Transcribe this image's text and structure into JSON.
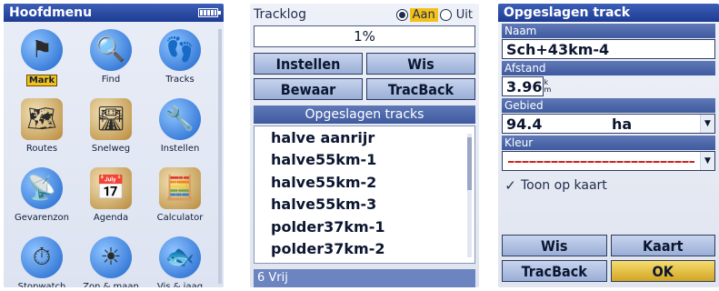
{
  "menu": {
    "title": "Hoofdmenu",
    "items": [
      {
        "label": "Mark",
        "icon": "mark-flag-icon",
        "glyph": "⚑",
        "selected": true
      },
      {
        "label": "Find",
        "icon": "magnifier-icon",
        "glyph": "🔍"
      },
      {
        "label": "Tracks",
        "icon": "tracks-icon",
        "glyph": "👣"
      },
      {
        "label": "Routes",
        "icon": "routes-map-icon",
        "glyph": "🗺"
      },
      {
        "label": "Snelweg",
        "icon": "highway-icon",
        "glyph": "🛣"
      },
      {
        "label": "Instellen",
        "icon": "wrench-icon",
        "glyph": "🔧"
      },
      {
        "label": "Gevarenzon",
        "icon": "proximity-icon",
        "glyph": "📡"
      },
      {
        "label": "Agenda",
        "icon": "calendar-icon",
        "glyph": "📅"
      },
      {
        "label": "Calculator",
        "icon": "calculator-icon",
        "glyph": "🧮"
      },
      {
        "label": "Stopwatch",
        "icon": "stopwatch-icon",
        "glyph": "⏱"
      },
      {
        "label": "Zon & maan",
        "icon": "sun-moon-icon",
        "glyph": "☀"
      },
      {
        "label": "Vis & jaag",
        "icon": "fish-hunt-icon",
        "glyph": "🐟"
      }
    ]
  },
  "tracks": {
    "tracklog_label": "Tracklog",
    "on_label": "Aan",
    "off_label": "Uit",
    "on_selected": true,
    "progress_text": "1%",
    "progress_fraction": 0.01,
    "buttons": {
      "setup": "Instellen",
      "clear": "Wis",
      "save": "Bewaar",
      "tracback": "TracBack"
    },
    "saved_header": "Opgeslagen tracks",
    "items": [
      "halve aanrijr",
      "halve55km-1",
      "halve55km-2",
      "halve55km-3",
      "polder37km-1",
      "polder37km-2"
    ],
    "free_text": "6 Vrij"
  },
  "saved_track": {
    "title": "Opgeslagen track",
    "name_label": "Naam",
    "name_value": "Sch+43km-4",
    "distance_label": "Afstand",
    "distance_value": "3.96",
    "distance_unit_top": "k",
    "distance_unit_bottom": "m",
    "area_label": "Gebied",
    "area_value": "94.4",
    "area_unit": "ha",
    "color_label": "Kleur",
    "color_value": "#cc2222",
    "show_on_map_label": "Toon op kaart",
    "show_on_map_checked": true,
    "buttons": {
      "clear": "Wis",
      "map": "Kaart",
      "tracback": "TracBack",
      "ok": "OK"
    }
  }
}
